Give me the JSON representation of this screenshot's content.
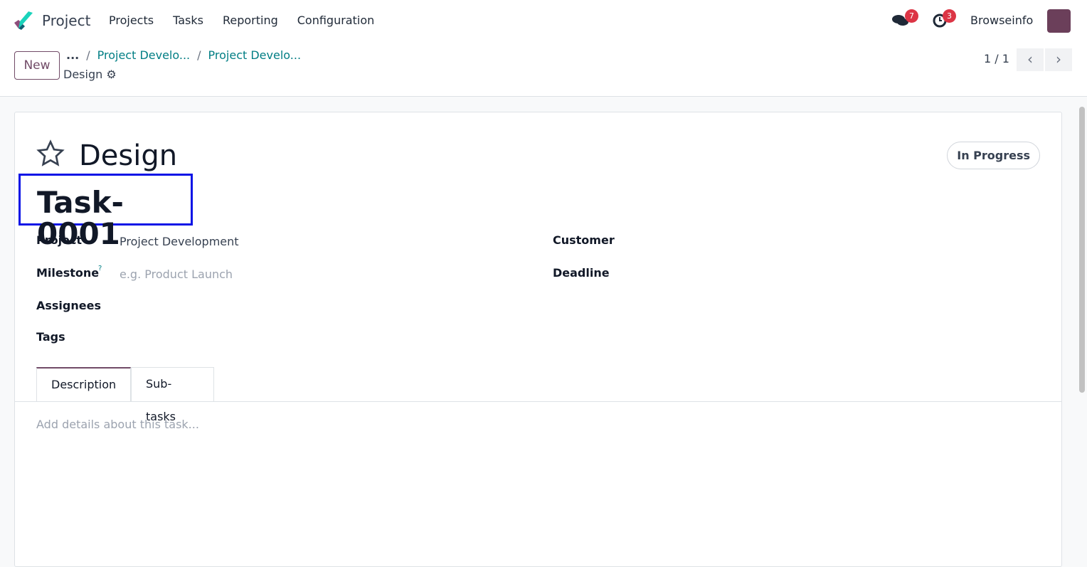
{
  "nav": {
    "app": "Project",
    "menu": [
      "Projects",
      "Tasks",
      "Reporting",
      "Configuration"
    ],
    "messages_count": "7",
    "activities_count": "3",
    "user": "Browseinfo"
  },
  "control": {
    "new_label": "New",
    "ellipsis": "...",
    "breadcrumbs": [
      "Project Develo...",
      "Project Develo..."
    ],
    "current": "Design",
    "pager": "1 / 1"
  },
  "task": {
    "name": "Design",
    "status": "In Progress",
    "reference": "Task-0001",
    "fields": {
      "project_label": "Project",
      "project_value": "Project Development",
      "milestone_label": "Milestone",
      "milestone_help": "?",
      "milestone_placeholder": "e.g. Product Launch",
      "assignees_label": "Assignees",
      "tags_label": "Tags",
      "customer_label": "Customer",
      "deadline_label": "Deadline"
    },
    "tabs": [
      "Description",
      "Sub-tasks"
    ],
    "description_placeholder": "Add details about this task..."
  }
}
